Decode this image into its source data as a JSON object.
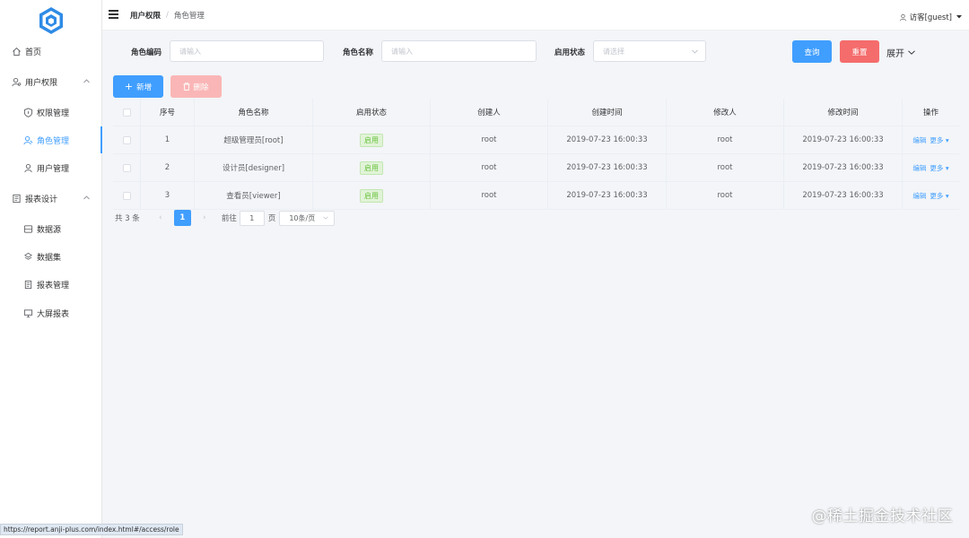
{
  "sidebar": {
    "items": [
      {
        "label": "首页",
        "icon": "home-icon"
      },
      {
        "label": "用户权限",
        "icon": "user-group-icon"
      },
      {
        "label": "权限管理",
        "icon": "shield-icon"
      },
      {
        "label": "角色管理",
        "icon": "role-icon"
      },
      {
        "label": "用户管理",
        "icon": "user-icon"
      },
      {
        "label": "报表设计",
        "icon": "report-icon"
      },
      {
        "label": "数据源",
        "icon": "database-icon"
      },
      {
        "label": "数据集",
        "icon": "dataset-icon"
      },
      {
        "label": "报表管理",
        "icon": "document-icon"
      },
      {
        "label": "大屏报表",
        "icon": "screen-icon"
      }
    ],
    "active_item": "角色管理"
  },
  "header": {
    "breadcrumb": [
      "用户权限",
      "角色管理"
    ],
    "breadcrumb_separator": "/",
    "user": "访客[guest]"
  },
  "filters": {
    "role_code_label": "角色编码",
    "role_code_placeholder": "请输入",
    "role_name_label": "角色名称",
    "role_name_placeholder": "请输入",
    "status_label": "启用状态",
    "status_placeholder": "请选择",
    "query_label": "查询",
    "reset_label": "重置",
    "expand_label": "展开"
  },
  "actions": {
    "add_label": "新增",
    "delete_label": "删除"
  },
  "table": {
    "headers": [
      "序号",
      "角色名称",
      "启用状态",
      "创建人",
      "创建时间",
      "修改人",
      "修改时间",
      "操作"
    ],
    "rows": [
      {
        "no": "1",
        "name": "超级管理员[root]",
        "status": "启用",
        "creator": "root",
        "created": "2019-07-23 16:00:33",
        "modifier": "root",
        "modified": "2019-07-23 16:00:33",
        "edit": "编辑",
        "more": "更多"
      },
      {
        "no": "2",
        "name": "设计员[designer]",
        "status": "启用",
        "creator": "root",
        "created": "2019-07-23 16:00:33",
        "modifier": "root",
        "modified": "2019-07-23 16:00:33",
        "edit": "编辑",
        "more": "更多"
      },
      {
        "no": "3",
        "name": "查看员[viewer]",
        "status": "启用",
        "creator": "root",
        "created": "2019-07-23 16:00:33",
        "modifier": "root",
        "modified": "2019-07-23 16:00:33",
        "edit": "编辑",
        "more": "更多"
      }
    ]
  },
  "pagination": {
    "total": "共 3 条",
    "current_page": "1",
    "goto_label": "前往",
    "goto_value": "1",
    "page_unit": "页",
    "page_size": "10条/页"
  },
  "status_bar": "https://report.anji-plus.com/index.html#/access/role",
  "watermark": "@稀土掘金技术社区",
  "colors": {
    "primary": "#409eff",
    "danger": "#f56c6c",
    "success": "#67c23a",
    "background": "#f3f5f8"
  }
}
